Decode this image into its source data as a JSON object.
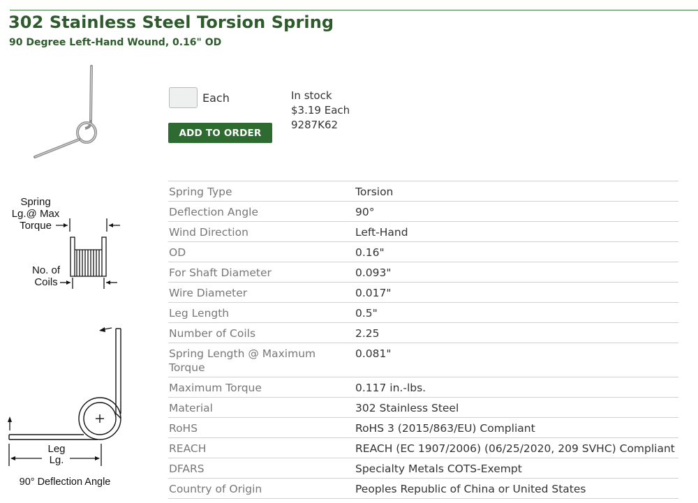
{
  "product": {
    "title": "302 Stainless Steel Torsion Spring",
    "subtitle": "90 Degree Left-Hand Wound, 0.16\" OD"
  },
  "diagram": {
    "spring_length_label": "Spring\nLg.@ Max\nTorque",
    "coils_label": "No. of\nCoils",
    "leg_label": "Leg\nLg.",
    "angle_caption": "90° Deflection Angle"
  },
  "order": {
    "quantity_value": "",
    "unit": "Each",
    "add_button": "ADD TO ORDER",
    "availability": "In stock",
    "price": "$3.19 Each",
    "part_number": "9287K62"
  },
  "specs": [
    {
      "label": "Spring Type",
      "value": "Torsion"
    },
    {
      "label": "Deflection Angle",
      "value": "90°"
    },
    {
      "label": "Wind Direction",
      "value": "Left-Hand"
    },
    {
      "label": "OD",
      "value": "0.16\""
    },
    {
      "label": "For Shaft Diameter",
      "value": "0.093\""
    },
    {
      "label": "Wire Diameter",
      "value": "0.017\""
    },
    {
      "label": "Leg Length",
      "value": "0.5\""
    },
    {
      "label": "Number of Coils",
      "value": "2.25"
    },
    {
      "label": "Spring Length @ Maximum Torque",
      "value": "0.081\""
    },
    {
      "label": "Maximum Torque",
      "value": "0.117 in.-lbs."
    },
    {
      "label": "Material",
      "value": "302 Stainless Steel"
    },
    {
      "label": "RoHS",
      "value": "RoHS 3 (2015/863/EU) Compliant"
    },
    {
      "label": "REACH",
      "value": "REACH (EC 1907/2006) (06/25/2020, 209 SVHC) Compliant"
    },
    {
      "label": "DFARS",
      "value": "Specialty Metals COTS-Exempt"
    },
    {
      "label": "Country of Origin",
      "value": "Peoples Republic of China or United States"
    }
  ],
  "colors": {
    "brand_green": "#2d5b2b",
    "button_green": "#2e6b30"
  },
  "icons": [
    "torsion-spring-photo",
    "spring-length-diagram",
    "deflection-angle-diagram"
  ]
}
